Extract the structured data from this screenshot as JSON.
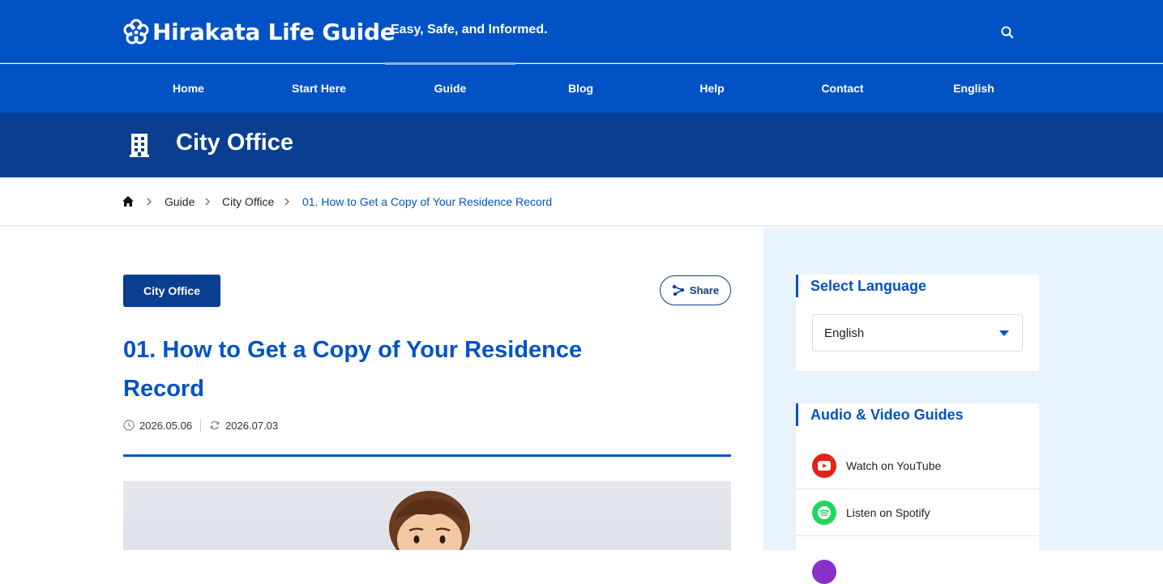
{
  "site": {
    "logo_text": "Hirakata Life Guide",
    "tagline": "Easy, Safe, and Informed."
  },
  "nav": {
    "items": [
      {
        "label": "Home"
      },
      {
        "label": "Start Here"
      },
      {
        "label": "Guide",
        "active": true
      },
      {
        "label": "Blog"
      },
      {
        "label": "Help"
      },
      {
        "label": "Contact"
      },
      {
        "label": "English"
      }
    ]
  },
  "page_header": {
    "title": "City Office",
    "icon": "building-icon"
  },
  "breadcrumb": {
    "home_icon": "home-icon",
    "items": [
      "Guide",
      "City Office",
      "01. How to Get a Copy of Your Residence Record"
    ]
  },
  "article": {
    "category": "City Office",
    "share_label": "Share",
    "title": "01. How to Get a Copy of Your Residence Record",
    "published": "2026.05.06",
    "updated": "2026.07.03"
  },
  "sidebar": {
    "language": {
      "title": "Select Language",
      "selected": "English"
    },
    "media": {
      "title": "Audio & Video Guides",
      "items": [
        {
          "label": "Watch on YouTube",
          "icon": "youtube-icon",
          "color": "#e62117"
        },
        {
          "label": "Listen on Spotify",
          "icon": "spotify-icon",
          "color": "#1ed760"
        }
      ]
    }
  },
  "colors": {
    "primary": "#0153c5",
    "dark": "#0a3e91",
    "sidebar_bg": "#e8f4fd"
  }
}
